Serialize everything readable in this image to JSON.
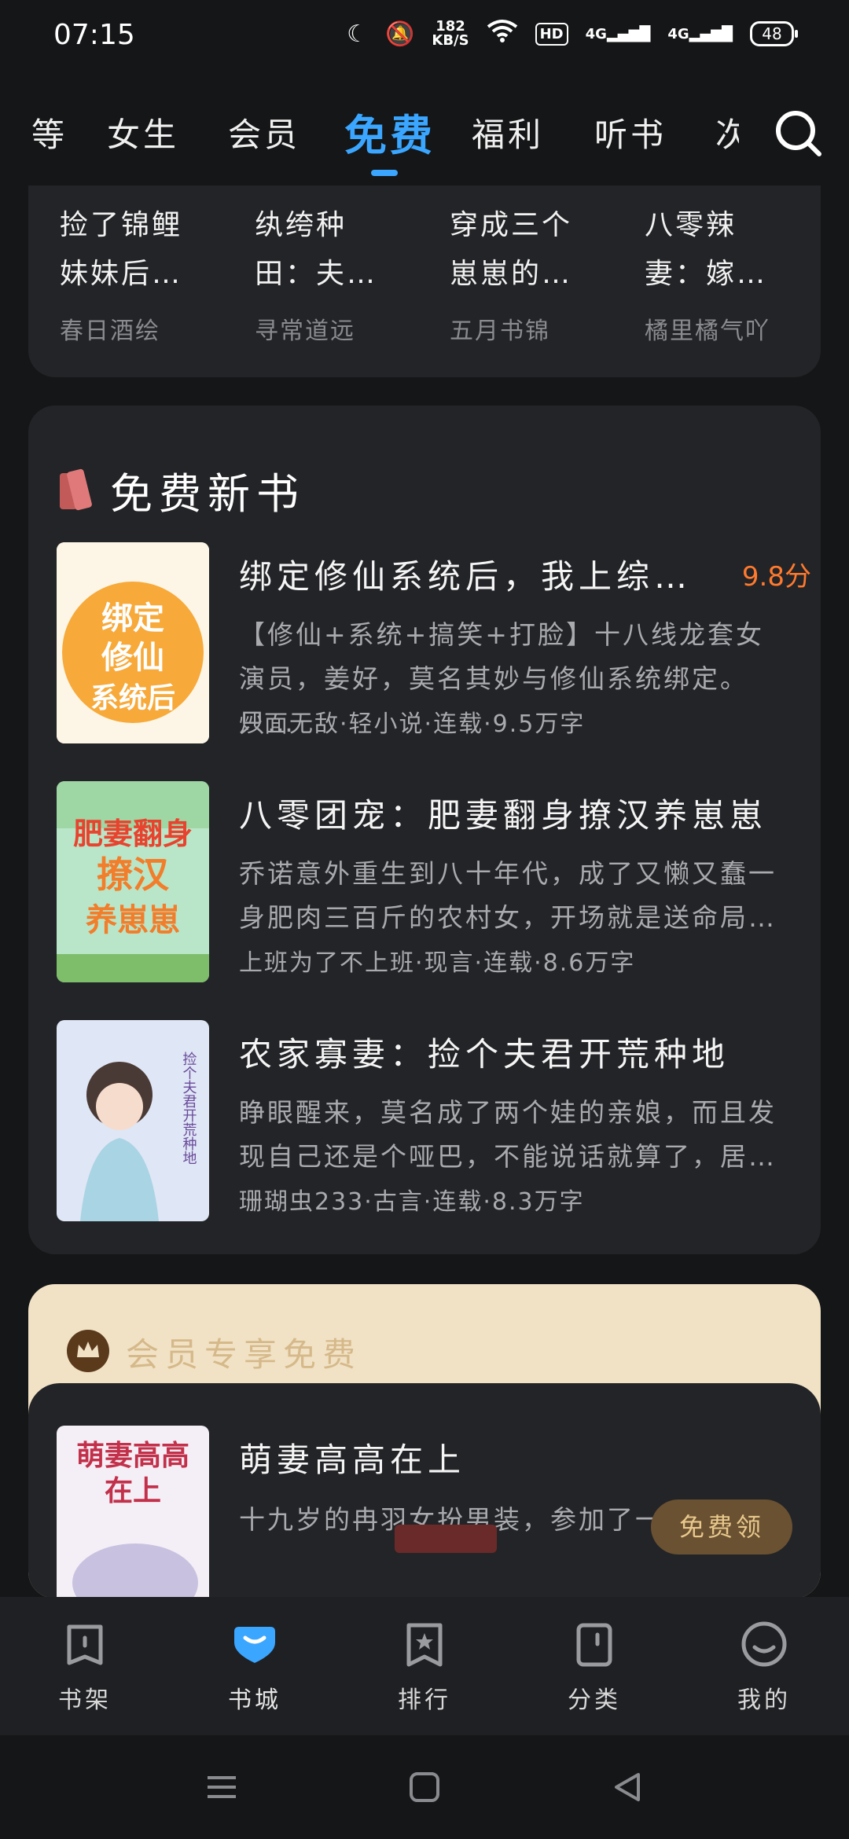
{
  "status": {
    "time": "07:15",
    "speed_top": "182",
    "speed_bottom": "KB/S",
    "hd": "HD",
    "sig1": "4G",
    "sig2": "4G",
    "battery": "48"
  },
  "tabs": [
    {
      "label": "等",
      "active": false
    },
    {
      "label": "女生",
      "active": false
    },
    {
      "label": "会员",
      "active": false
    },
    {
      "label": "免费",
      "active": true
    },
    {
      "label": "福利",
      "active": false
    },
    {
      "label": "听书",
      "active": false
    },
    {
      "label": "次",
      "active": false
    }
  ],
  "top_books": [
    {
      "title1": "捡了锦鲤",
      "title2": "妹妹后…",
      "author": "春日酒绘"
    },
    {
      "title1": "纨绔种",
      "title2": "田：夫…",
      "author": "寻常道远"
    },
    {
      "title1": "穿成三个",
      "title2": "崽崽的…",
      "author": "五月书锦"
    },
    {
      "title1": "八零辣",
      "title2": "妻：嫁…",
      "author": "橘里橘气吖"
    }
  ],
  "new_books": {
    "title": "免费新书",
    "items": [
      {
        "title": "绑定修仙系统后，我上综…",
        "score": "9.8分",
        "desc": "【修仙+系统+搞笑+打脸】十八线龙套女演员，姜好，莫名其妙与修仙系统绑定。只…",
        "meta": "炒面无敌·轻小说·连载·9.5万字",
        "cover_text": "绑定修仙系统后"
      },
      {
        "title": "八零团宠：肥妻翻身撩汉养崽崽",
        "score": "",
        "desc": "乔诺意外重生到八十年代，成了又懒又蠢一身肥肉三百斤的农村女，开场就是送命局…",
        "meta": "上班为了不上班·现言·连载·8.6万字",
        "cover_text": "肥妻翻身撩汉养崽崽"
      },
      {
        "title": "农家寡妻：捡个夫君开荒种地",
        "score": "",
        "desc": "睁眼醒来，莫名成了两个娃的亲娘，而且发现自己还是个哑巴，不能说话就算了，居…",
        "meta": "珊瑚虫233·古言·连载·8.3万字",
        "cover_text": "捡个夫君开荒种地"
      }
    ]
  },
  "vip": {
    "title": "会员专享免费",
    "book_title": "萌妻高高在上",
    "desc": "十九岁的冉羽女扮男装，参加了一场豪门…",
    "button": "免费领",
    "cover_text": "萌妻高高在上"
  },
  "bottom_nav": [
    {
      "label": "书架",
      "icon": "bookshelf-icon"
    },
    {
      "label": "书城",
      "icon": "bookstore-icon",
      "active": true
    },
    {
      "label": "排行",
      "icon": "ranking-icon"
    },
    {
      "label": "分类",
      "icon": "category-icon"
    },
    {
      "label": "我的",
      "icon": "profile-icon"
    }
  ],
  "colors": {
    "accent": "#3aa6ff",
    "score": "#ff7a2e",
    "card": "#232427",
    "background": "#151617"
  }
}
